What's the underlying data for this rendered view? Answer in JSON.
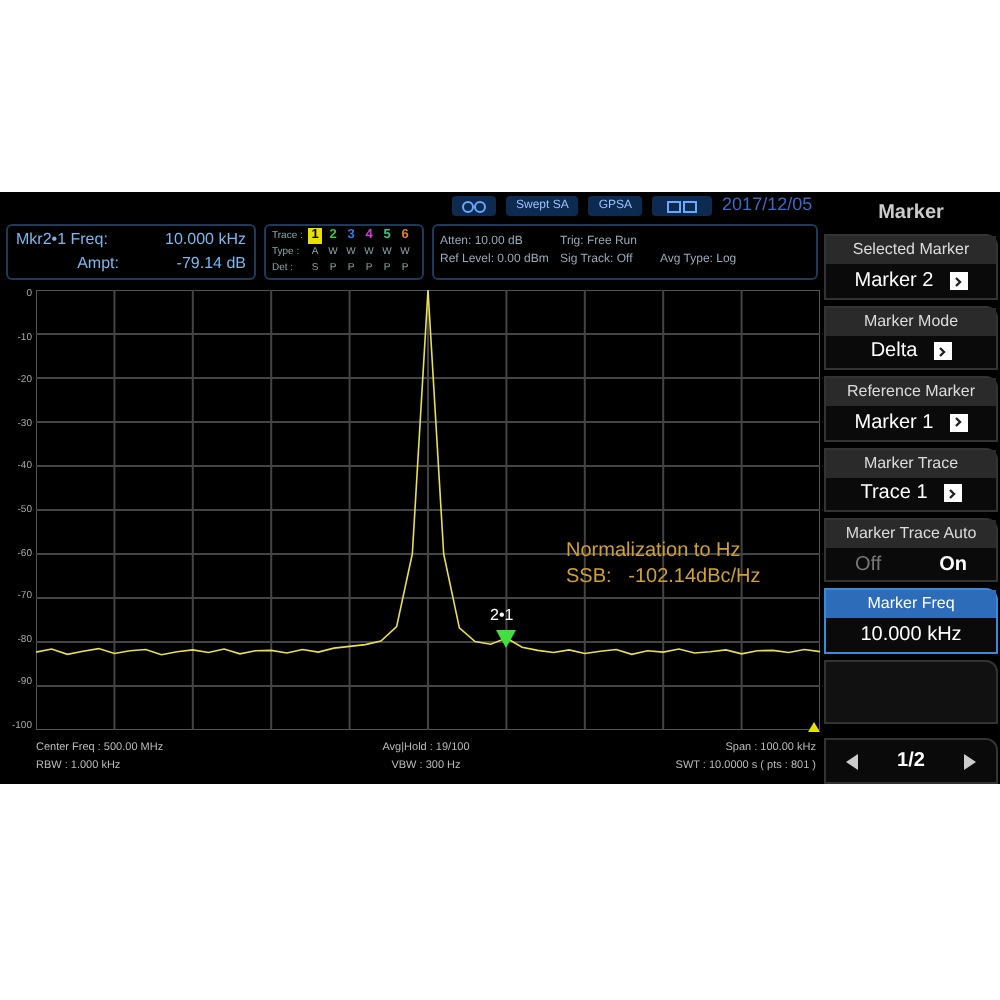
{
  "top_bar": {
    "buttons": [
      "Swept SA",
      "GPSA"
    ],
    "date": "2017/12/05",
    "menu_title": "Marker"
  },
  "marker_readout": {
    "freq_label": "Mkr2•1 Freq:",
    "freq_value": "10.000 kHz",
    "ampt_label": "Ampt:",
    "ampt_value": "-79.14 dB"
  },
  "trace_table": {
    "trace_label": "Trace :",
    "type_label": "Type :",
    "det_label": "Det :",
    "traces": [
      {
        "number": "1",
        "type": "A",
        "det": "S",
        "color": "#e8e000",
        "selected": true
      },
      {
        "number": "2",
        "type": "W",
        "det": "P",
        "color": "#40c040",
        "selected": false
      },
      {
        "number": "3",
        "type": "W",
        "det": "P",
        "color": "#3a7ad8",
        "selected": false
      },
      {
        "number": "4",
        "type": "W",
        "det": "P",
        "color": "#d040d0",
        "selected": false
      },
      {
        "number": "5",
        "type": "W",
        "det": "P",
        "color": "#40c080",
        "selected": false
      },
      {
        "number": "6",
        "type": "W",
        "det": "P",
        "color": "#e08030",
        "selected": false
      }
    ]
  },
  "settings": [
    "Atten: 10.00 dB",
    "Trig: Free Run",
    "Ref Level: 0.00 dBm",
    "Sig Track: Off",
    "Avg Type: Log"
  ],
  "plot": {
    "chart_data": {
      "type": "line",
      "grid": true,
      "ylim": [
        -100,
        0
      ],
      "yticks": [
        0,
        -10,
        -20,
        -30,
        -40,
        -50,
        -60,
        -70,
        -80,
        -90,
        -100
      ],
      "categories": [
        null,
        null,
        null,
        null,
        null,
        null,
        null,
        null,
        null,
        null,
        null,
        null,
        null,
        null,
        null,
        null,
        null,
        null,
        null,
        null,
        null,
        null,
        null,
        null,
        null,
        null,
        null,
        null,
        null,
        null,
        null,
        null,
        null,
        null,
        null,
        null,
        null,
        null,
        null,
        null,
        null,
        null,
        null,
        null,
        null,
        null,
        null,
        null,
        null,
        null,
        null
      ],
      "series": [
        {
          "color": "#e8e050",
          "values": [
            -82.3,
            -81.6,
            -82.8,
            -82.1,
            -81.5,
            -82.6,
            -82.0,
            -81.7,
            -82.9,
            -82.2,
            -81.8,
            -82.4,
            -81.6,
            -82.7,
            -82.0,
            -81.9,
            -82.5,
            -81.7,
            -82.3,
            -81.4,
            -81.0,
            -80.6,
            -79.8,
            -76.5,
            -60.0,
            0.0,
            -60.0,
            -76.8,
            -79.9,
            -80.5,
            -79.1,
            -81.2,
            -81.9,
            -82.4,
            -81.8,
            -82.6,
            -82.1,
            -81.7,
            -82.8,
            -82.0,
            -82.3,
            -81.6,
            -82.5,
            -82.2,
            -81.8,
            -82.7,
            -82.0,
            -81.9,
            -82.4,
            -81.7,
            -82.2
          ]
        }
      ]
    },
    "marker_label": "2•1",
    "annotation": [
      "Normalization to Hz",
      "SSB:   -102.14dBc/Hz"
    ]
  },
  "footer": {
    "center_freq": "Center Freq : 500.00 MHz",
    "avg_hold": "Avg|Hold : 19/100",
    "span": "Span : 100.00 kHz",
    "rbw": "RBW : 1.000 kHz",
    "vbw": "VBW : 300 Hz",
    "swt": "SWT : 10.0000 s ( pts : 801 )"
  },
  "softkeys": [
    {
      "kind": "select",
      "title": "Selected Marker",
      "value": "Marker 2"
    },
    {
      "kind": "select",
      "title": "Marker Mode",
      "value": "Delta"
    },
    {
      "kind": "select",
      "title": "Reference Marker",
      "value": "Marker 1"
    },
    {
      "kind": "select",
      "title": "Marker Trace",
      "value": "Trace 1"
    },
    {
      "kind": "toggle",
      "title": "Marker Trace Auto",
      "off": "Off",
      "on": "On",
      "selected": true
    },
    {
      "kind": "value",
      "title": "Marker Freq",
      "value": "10.000 kHz",
      "selected": true
    },
    {
      "kind": "empty"
    }
  ],
  "pager": {
    "text": "1/2"
  }
}
